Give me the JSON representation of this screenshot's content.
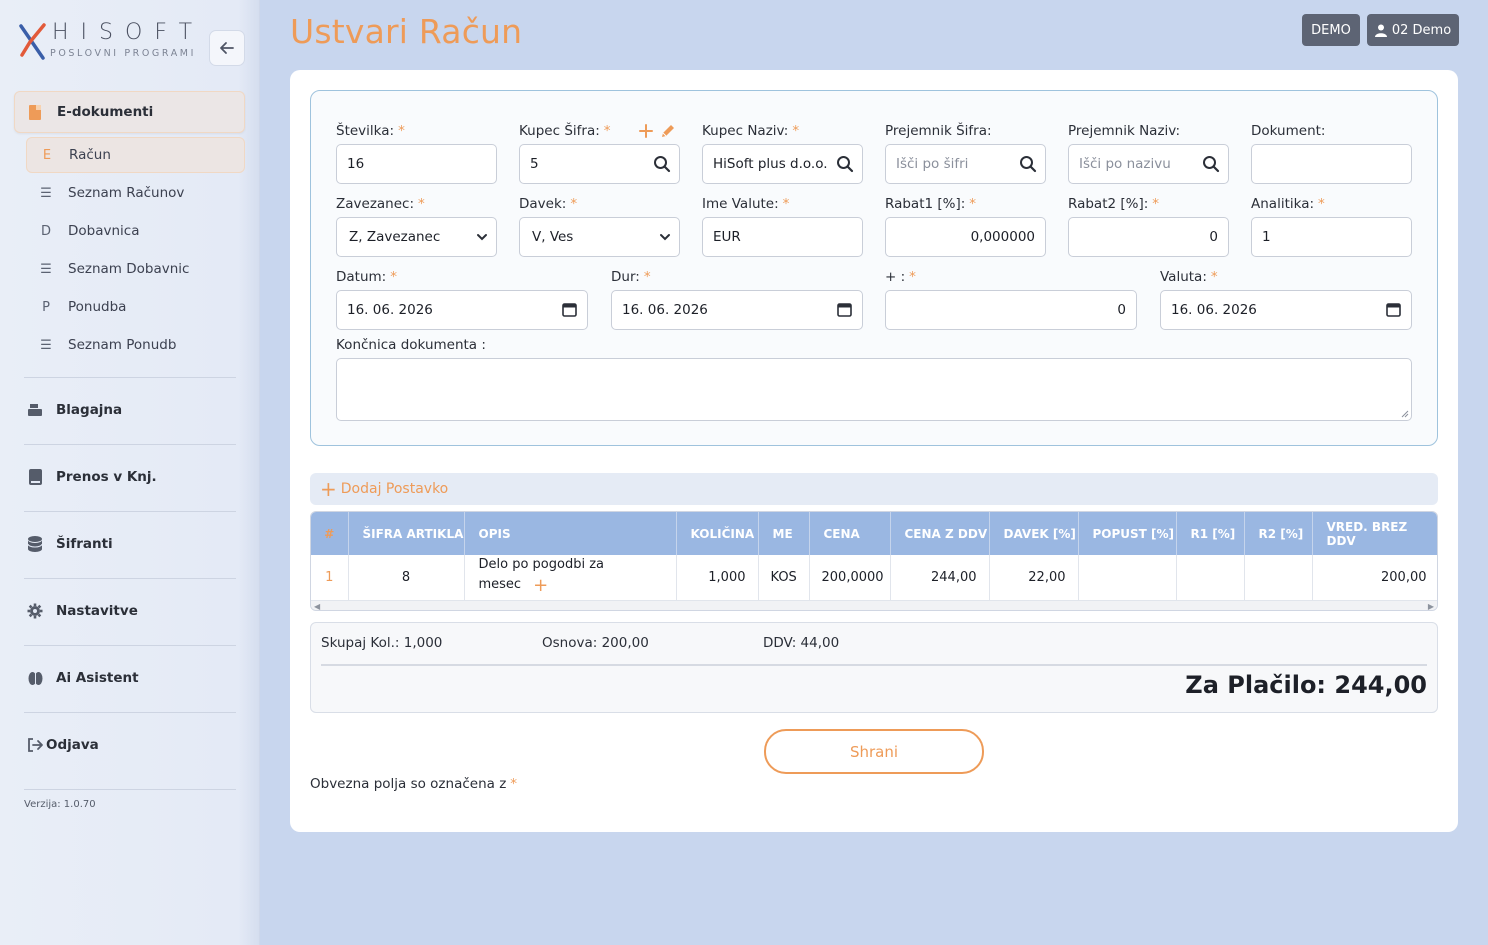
{
  "brand": {
    "name": "HISOFT",
    "tagline": "POSLOVNI PROGRAMI"
  },
  "header": {
    "title": "Ustvari Račun",
    "demo_badge": "DEMO",
    "user": "02 Demo"
  },
  "sidebar": {
    "group": "E-dokumenti",
    "sub_items": [
      {
        "icon": "E",
        "label": "Račun"
      },
      {
        "icon": "list",
        "label": "Seznam Računov"
      },
      {
        "icon": "D",
        "label": "Dobavnica"
      },
      {
        "icon": "list",
        "label": "Seznam Dobavnic"
      },
      {
        "icon": "P",
        "label": "Ponudba"
      },
      {
        "icon": "list",
        "label": "Seznam Ponudb"
      }
    ],
    "main_items": [
      {
        "icon": "cash-register-icon",
        "label": "Blagajna"
      },
      {
        "icon": "book-icon",
        "label": "Prenos v Knj."
      },
      {
        "icon": "database-icon",
        "label": "Šifranti"
      },
      {
        "icon": "gear-icon",
        "label": "Nastavitve"
      },
      {
        "icon": "brain-icon",
        "label": "Ai Asistent"
      },
      {
        "icon": "logout-icon",
        "label": "Odjava"
      }
    ],
    "version": "Verzija: 1.0.70"
  },
  "form": {
    "stevilka": {
      "label": "Številka:",
      "value": "16"
    },
    "kupec_sifra": {
      "label": "Kupec Šifra:",
      "value": "5"
    },
    "kupec_naziv": {
      "label": "Kupec Naziv:",
      "value": "HiSoft plus d.o.o."
    },
    "prejemnik_sifra": {
      "label": "Prejemnik Šifra:",
      "placeholder": "Išči po šifri"
    },
    "prejemnik_naziv": {
      "label": "Prejemnik Naziv:",
      "placeholder": "Išči po nazivu"
    },
    "dokument": {
      "label": "Dokument:",
      "value": ""
    },
    "zavezanec": {
      "label": "Zavezanec:",
      "value": "Z, Zavezanec"
    },
    "davek": {
      "label": "Davek:",
      "value": "V, Ves"
    },
    "ime_valute": {
      "label": "Ime Valute:",
      "value": "EUR"
    },
    "rabat1": {
      "label": "Rabat1 [%]:",
      "value": "0,000000"
    },
    "rabat2": {
      "label": "Rabat2 [%]:",
      "value": "0"
    },
    "analitika": {
      "label": "Analitika:",
      "value": "1"
    },
    "datum": {
      "label": "Datum:",
      "value": "16. 06. 2026"
    },
    "dur": {
      "label": "Dur:",
      "value": "16. 06. 2026"
    },
    "plus": {
      "label": "+ :",
      "value": "0"
    },
    "valuta": {
      "label": "Valuta:",
      "value": "16. 06. 2026"
    },
    "koncnica": {
      "label": "Končnica dokumenta :",
      "value": ""
    },
    "required_mark": "*"
  },
  "add_item": "Dodaj Postavko",
  "table": {
    "headers": [
      "#",
      "ŠIFRA ARTIKLA",
      "OPIS",
      "KOLIČINA",
      "ME",
      "CENA",
      "CENA Z DDV",
      "DAVEK [%]",
      "POPUST [%]",
      "R1 [%]",
      "R2 [%]",
      "VRED. BREZ DDV"
    ],
    "rows": [
      [
        "1",
        "8",
        "Delo po pogodbi za mesec",
        "1,000",
        "KOS",
        "200,0000",
        "244,00",
        "22,00",
        "",
        "",
        "",
        "200,00"
      ]
    ]
  },
  "totals": {
    "kolicina": "Skupaj Kol.: 1,000",
    "osnova": "Osnova: 200,00",
    "ddv": "DDV: 44,00",
    "za_placilo": "Za Plačilo: 244,00"
  },
  "save_button": "Shrani",
  "note": "Obvezna polja so označena z",
  "colors": {
    "accent": "#ee9b58",
    "table_header": "#9ab7e2",
    "badge": "#5d6474",
    "background": "#c8d6ee"
  }
}
